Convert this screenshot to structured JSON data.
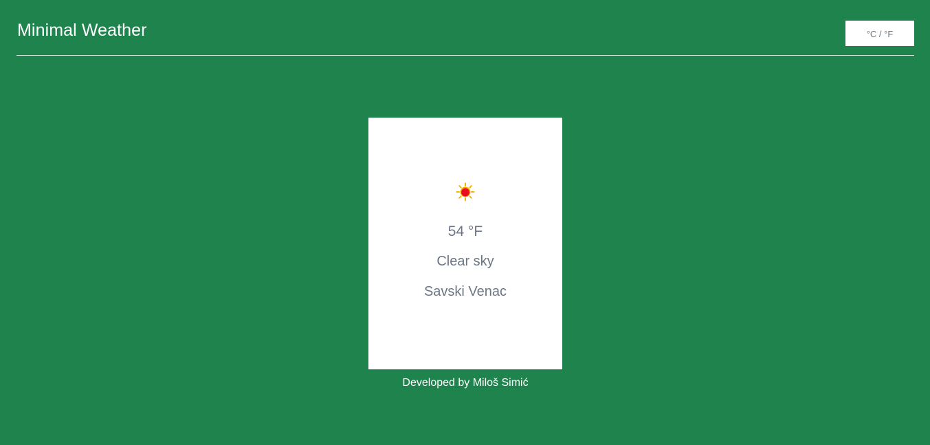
{
  "header": {
    "title": "Minimal Weather",
    "unit_toggle_label": "°C / °F"
  },
  "weather": {
    "icon": "sun-icon",
    "temperature": "54 °F",
    "description": "Clear sky",
    "location": "Savski Venac"
  },
  "footer": {
    "prefix": "Developed by ",
    "author": "Miloš Simić"
  },
  "colors": {
    "background": "#1f834d",
    "card": "#ffffff",
    "text_muted": "#6b7685",
    "sun_core": "#e8101e",
    "sun_rays": "#f6b300"
  }
}
